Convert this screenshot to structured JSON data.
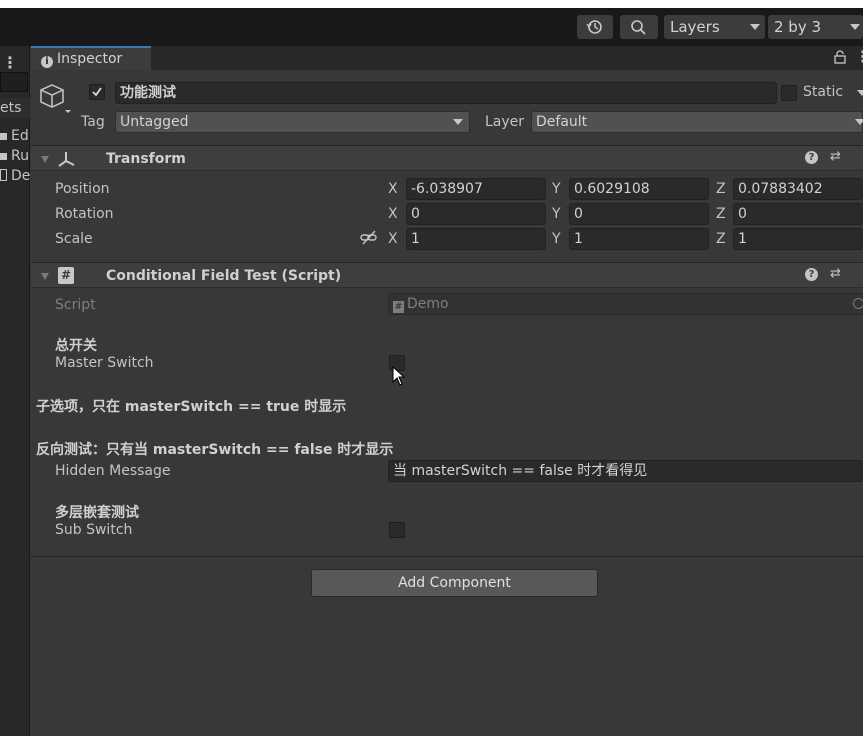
{
  "toolbar": {
    "layers_label": "Layers",
    "layout_label": "2 by 3"
  },
  "left_panel": {
    "truncated_label": "ets",
    "items": [
      "Ed",
      "Ru",
      "De"
    ]
  },
  "tab": {
    "title": "Inspector"
  },
  "gameobject": {
    "active": true,
    "name": "功能测试",
    "static_label": "Static",
    "tag_label": "Tag",
    "tag_value": "Untagged",
    "layer_label": "Layer",
    "layer_value": "Default"
  },
  "transform": {
    "title": "Transform",
    "rows": [
      {
        "label": "Position",
        "x": "-6.038907",
        "y": "0.6029108",
        "z": "0.07883402"
      },
      {
        "label": "Rotation",
        "x": "0",
        "y": "0",
        "z": "0"
      },
      {
        "label": "Scale",
        "x": "1",
        "y": "1",
        "z": "1"
      }
    ],
    "axis_x": "X",
    "axis_y": "Y",
    "axis_z": "Z"
  },
  "script_component": {
    "title": "Conditional Field Test (Script)",
    "script_label": "Script",
    "script_value": "Demo",
    "header_master": "总开关",
    "master_label": "Master Switch",
    "master_value": false,
    "note_sub": "子选项，只在 masterSwitch == true 时显示",
    "note_reverse": "反向测试：只有当 masterSwitch == false 时才显示",
    "hidden_label": "Hidden Message",
    "hidden_value": "当 masterSwitch == false 时才看得见",
    "header_nested": "多层嵌套测试",
    "sub_label": "Sub Switch",
    "sub_value": false
  },
  "add_component_label": "Add Component",
  "colors": {
    "accent_tab": "#3a79bb",
    "panel_bg": "#383838",
    "field_bg": "#2a2a2a",
    "toolbar_bg": "#191919"
  }
}
